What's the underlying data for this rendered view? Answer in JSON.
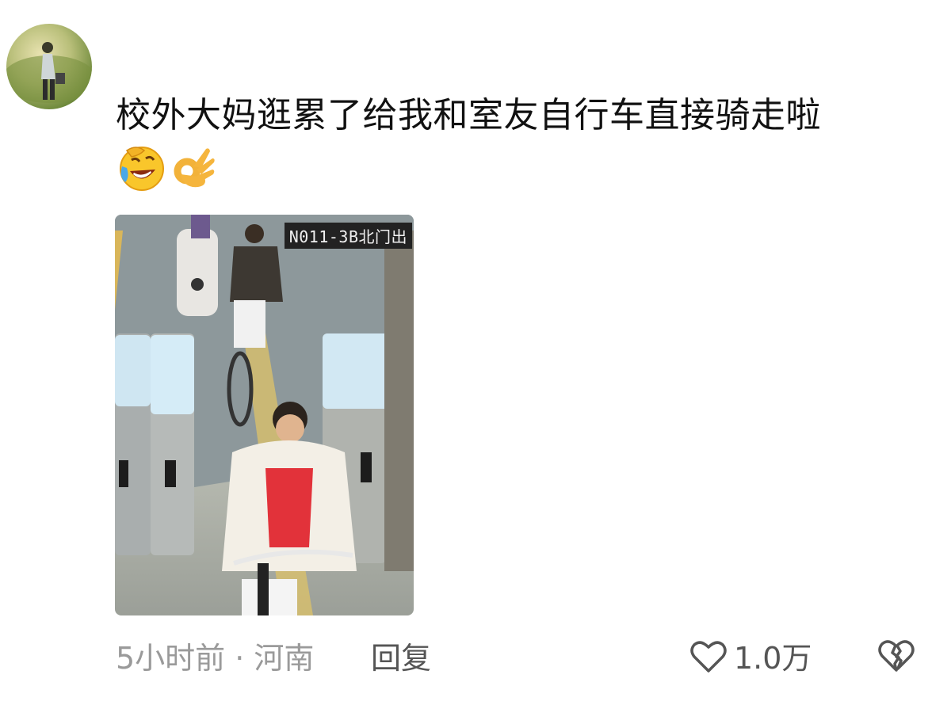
{
  "comment": {
    "text": "校外大妈逛累了给我和室友自行车直接骑走啦",
    "emojis": [
      "laughing-crying-emoji",
      "ok-hand-emoji"
    ]
  },
  "photo": {
    "camera_label": "N011-3B北门出"
  },
  "footer": {
    "time_location": "5小时前 · 河南",
    "reply_label": "回复",
    "like_count": "1.0万"
  },
  "icons": {
    "like": "heart-outline-icon",
    "dislike": "broken-heart-icon"
  }
}
